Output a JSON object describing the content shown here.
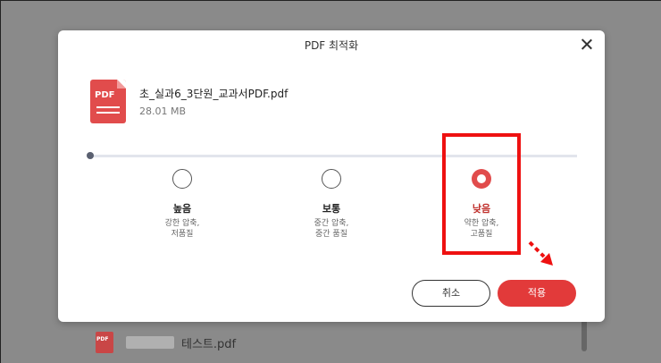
{
  "background": {
    "file_name": "테스트.pdf",
    "file_icon_label": "PDF"
  },
  "dialog": {
    "title": "PDF 최적화",
    "file": {
      "icon_label": "PDF",
      "name": "초_실과6_3단원_교과서PDF.pdf",
      "size": "28.01 MB"
    },
    "options": [
      {
        "title": "높음",
        "desc": "강한 압축,\n저품질",
        "selected": false
      },
      {
        "title": "보통",
        "desc": "중간 압축,\n중간 품질",
        "selected": false
      },
      {
        "title": "낮음",
        "desc": "약한 압축,\n고품질",
        "selected": true
      }
    ],
    "cancel_label": "취소",
    "apply_label": "적용"
  },
  "colors": {
    "accent": "#e23a3a",
    "highlight": "#ee1111",
    "overlay": "#8a8a8a"
  }
}
